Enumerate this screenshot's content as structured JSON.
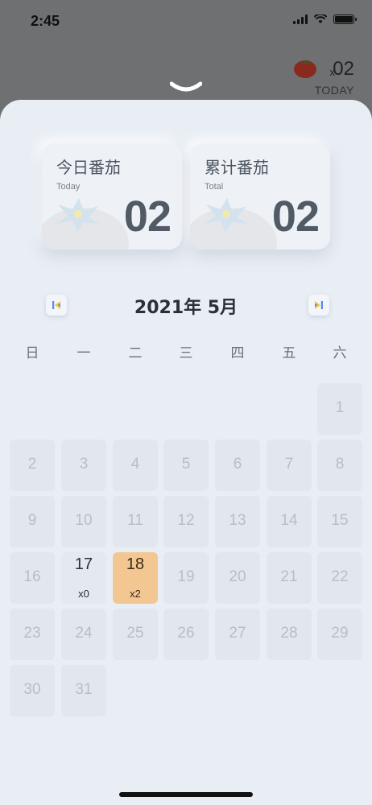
{
  "status_bar": {
    "time": "2:45"
  },
  "background": {
    "count_prefix": "x",
    "count": "02",
    "today_label": "TODAY"
  },
  "stats": [
    {
      "title": "今日番茄",
      "subtitle": "Today",
      "value": "02"
    },
    {
      "title": "累计番茄",
      "subtitle": "Total",
      "value": "02"
    }
  ],
  "calendar": {
    "title": "2021年  5月",
    "weekdays": [
      "日",
      "一",
      "二",
      "三",
      "四",
      "五",
      "六"
    ],
    "days": [
      {
        "d": "1"
      },
      {
        "d": "2"
      },
      {
        "d": "3"
      },
      {
        "d": "4"
      },
      {
        "d": "5"
      },
      {
        "d": "6"
      },
      {
        "d": "7"
      },
      {
        "d": "8"
      },
      {
        "d": "9"
      },
      {
        "d": "10"
      },
      {
        "d": "11"
      },
      {
        "d": "12"
      },
      {
        "d": "13"
      },
      {
        "d": "14"
      },
      {
        "d": "15"
      },
      {
        "d": "16"
      },
      {
        "d": "17",
        "count": "x0"
      },
      {
        "d": "18",
        "count": "x2"
      },
      {
        "d": "19"
      },
      {
        "d": "20"
      },
      {
        "d": "21"
      },
      {
        "d": "22"
      },
      {
        "d": "23"
      },
      {
        "d": "24"
      },
      {
        "d": "25"
      },
      {
        "d": "26"
      },
      {
        "d": "27"
      },
      {
        "d": "28"
      },
      {
        "d": "29"
      },
      {
        "d": "30"
      },
      {
        "d": "31"
      }
    ],
    "first_weekday_index": 6,
    "today_day": "18"
  },
  "icons": {
    "prev": "skip-previous-icon",
    "next": "skip-next-icon",
    "collapse": "chevron-down-icon"
  },
  "colors": {
    "today_cell": "#f2c791",
    "sheet": "#e9eef5",
    "nav_blue": "#4f8cf7",
    "nav_yellow": "#f5c542"
  }
}
